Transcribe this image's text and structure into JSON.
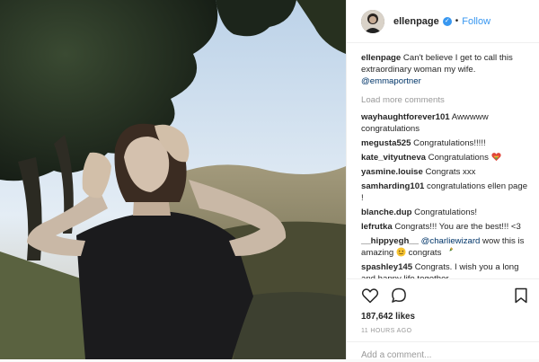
{
  "post": {
    "author": "ellenpage",
    "follow_label": "Follow",
    "separator": "•",
    "caption_text": " Can't believe I get to call this extraordinary woman my wife. ",
    "caption_mention": "@emmaportner",
    "load_more": "Load more comments",
    "comments": [
      {
        "user": "wayhaughtforever101",
        "text": " Awwwww congratulations"
      },
      {
        "user": "megusta525",
        "text": " Congratulations!!!!!"
      },
      {
        "user": "kate_vityutneva",
        "text": " Congratulations",
        "emoji": "rainbow-heart"
      },
      {
        "user": "yasmine.louise",
        "text": " Congrats xxx"
      },
      {
        "user": "samharding101",
        "text": " congratulations ellen page !"
      },
      {
        "user": "blanche.dup",
        "text": " Congratulations!"
      },
      {
        "user": "lefrutka",
        "text": " Congrats!!! You are the best!!! <3"
      },
      {
        "user": "__hippyegh__",
        "mention": "@charliewizard",
        "text": " wow this is amazing",
        "text2": " congrats",
        "emojis": [
          "smile-icon",
          "bottle-icon"
        ]
      },
      {
        "user": "spashley145",
        "text": " Congrats. I wish you a long and happy life together."
      }
    ],
    "likes": "187,642 likes",
    "timestamp": "11 HOURS AGO",
    "add_comment_placeholder": "Add a comment..."
  },
  "icons": {
    "verified": "verified-badge-icon",
    "like": "heart-icon",
    "comment": "comment-bubble-icon",
    "save": "bookmark-icon"
  },
  "colors": {
    "link_blue": "#3897f0",
    "mention": "#003569",
    "muted": "#999999",
    "text": "#262626"
  }
}
